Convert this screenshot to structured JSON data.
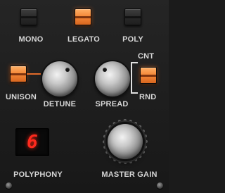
{
  "mode": {
    "mono_label": "MONO",
    "legato_label": "LEGATO",
    "poly_label": "POLY",
    "selected": "LEGATO"
  },
  "unison": {
    "label": "UNISON",
    "state": "on"
  },
  "detune": {
    "label": "DETUNE"
  },
  "spread": {
    "label": "SPREAD"
  },
  "spread_mode": {
    "top_label": "CNT",
    "bottom_label": "RND",
    "selected": "RND"
  },
  "polyphony": {
    "label": "POLYPHONY",
    "value": "6"
  },
  "master_gain": {
    "label": "MASTER GAIN"
  },
  "colors": {
    "accent": "#f58a3a",
    "led": "#ff2a1e",
    "panel": "#1d1d1d"
  },
  "icons": {
    "screw": "screw-icon"
  }
}
